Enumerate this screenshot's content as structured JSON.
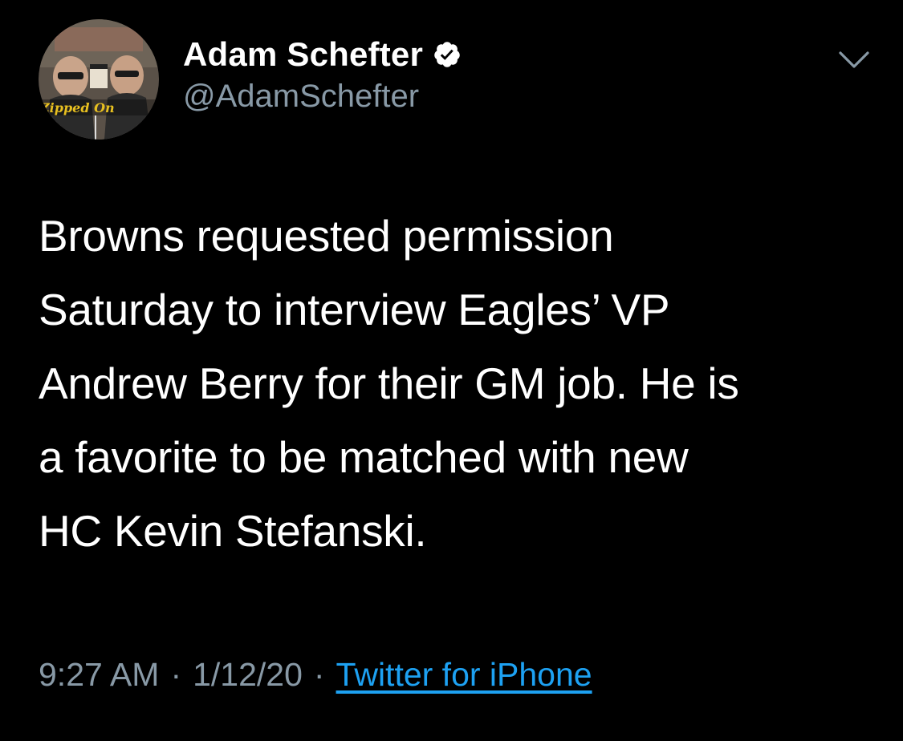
{
  "tweet": {
    "author": {
      "display_name": "Adam Schefter",
      "handle": "@AdamSchefter",
      "verified": true,
      "avatar_icon": "profile-photo",
      "avatar_banner_text": "Zipped On"
    },
    "text": "Browns requested permission\nSaturday to interview Eagles’ VP\nAndrew Berry for their GM job. He is\na favorite to be matched with new\nHC Kevin Stefanski.",
    "time": "9:27 AM",
    "separator": "·",
    "date": "1/12/20",
    "source": "Twitter for iPhone",
    "menu_icon": "chevron-down-icon"
  },
  "colors": {
    "background": "#000000",
    "primary_text": "#ffffff",
    "secondary_text": "#8899a6",
    "link": "#1da1f2"
  }
}
